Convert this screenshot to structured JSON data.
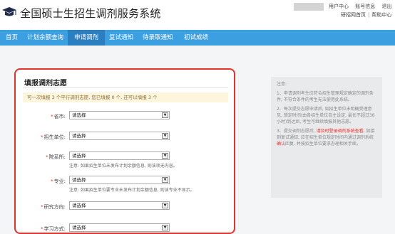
{
  "header": {
    "title": "全国硕士生招生调剂服务系统",
    "top_links": [
      "用户中心",
      "账号信息",
      "退出"
    ],
    "sub_links": [
      "研招网首页",
      "帮助中心"
    ]
  },
  "nav": {
    "items": [
      "首页",
      "计划余额查询",
      "申请调剂",
      "复试通知",
      "待录取通知",
      "初试成绩"
    ]
  },
  "form": {
    "title": "填报调剂志愿",
    "notice": "可一次填报 3 个平行调剂志愿, 您已填报 0 个, 还可以填报 3 个",
    "fields": [
      {
        "label": "省市:",
        "value": "请选择"
      },
      {
        "label": "招生单位:",
        "value": "请选择"
      },
      {
        "label": "院系所:",
        "value": "请选择",
        "hint": "注意: 如果招生单位未发布计划余额信息, 则该项无内容。"
      },
      {
        "label": "专业:",
        "value": "请选择",
        "hint": "注意: 如果招生单位要专业未发布计划余额信息, 则该专业不显示。"
      },
      {
        "label": "研究方向:",
        "value": "请选择"
      },
      {
        "label": "学习方式:",
        "value": "请选择"
      }
    ]
  },
  "sidenote": {
    "title": "注意:",
    "items": [
      "1、申请调剂考生应符合招生管理规定确定的调剂条件, 不符合条件的考生无法使用此系统。",
      "2、每次提交志愿申请后, 如招生单位未明确受理意见, 锁定时间(由各招生单位自主设定, 最长不超过36小时)到达后, 考生可继续填报其他志愿。",
      "3、提交调剂志愿后, 请及时登录调剂系统查看, 如接到复试通知, 应在招生单位规定时间内通过调剂系统确认回复, 并按招生单位要求办理相关手续。"
    ],
    "item3_parts": {
      "pre": "3、提交调剂志愿后, ",
      "red1": "请及时登录调剂系统查看",
      "mid": ", 如接到复试通知, 应在招生单位规定时间内通过调剂系统",
      "red2": "确认",
      "post": "回复, 并按招生单位要求办理相关手续。"
    }
  },
  "colors": {
    "nav_bg": "#3b9fe0",
    "nav_active": "#2b7fc0",
    "highlight_border": "#e5322d",
    "notice_bg": "#fdf5dc"
  },
  "icons": {
    "logo": "graduation-cap-icon",
    "select_arrow": "chevron-down-icon"
  }
}
